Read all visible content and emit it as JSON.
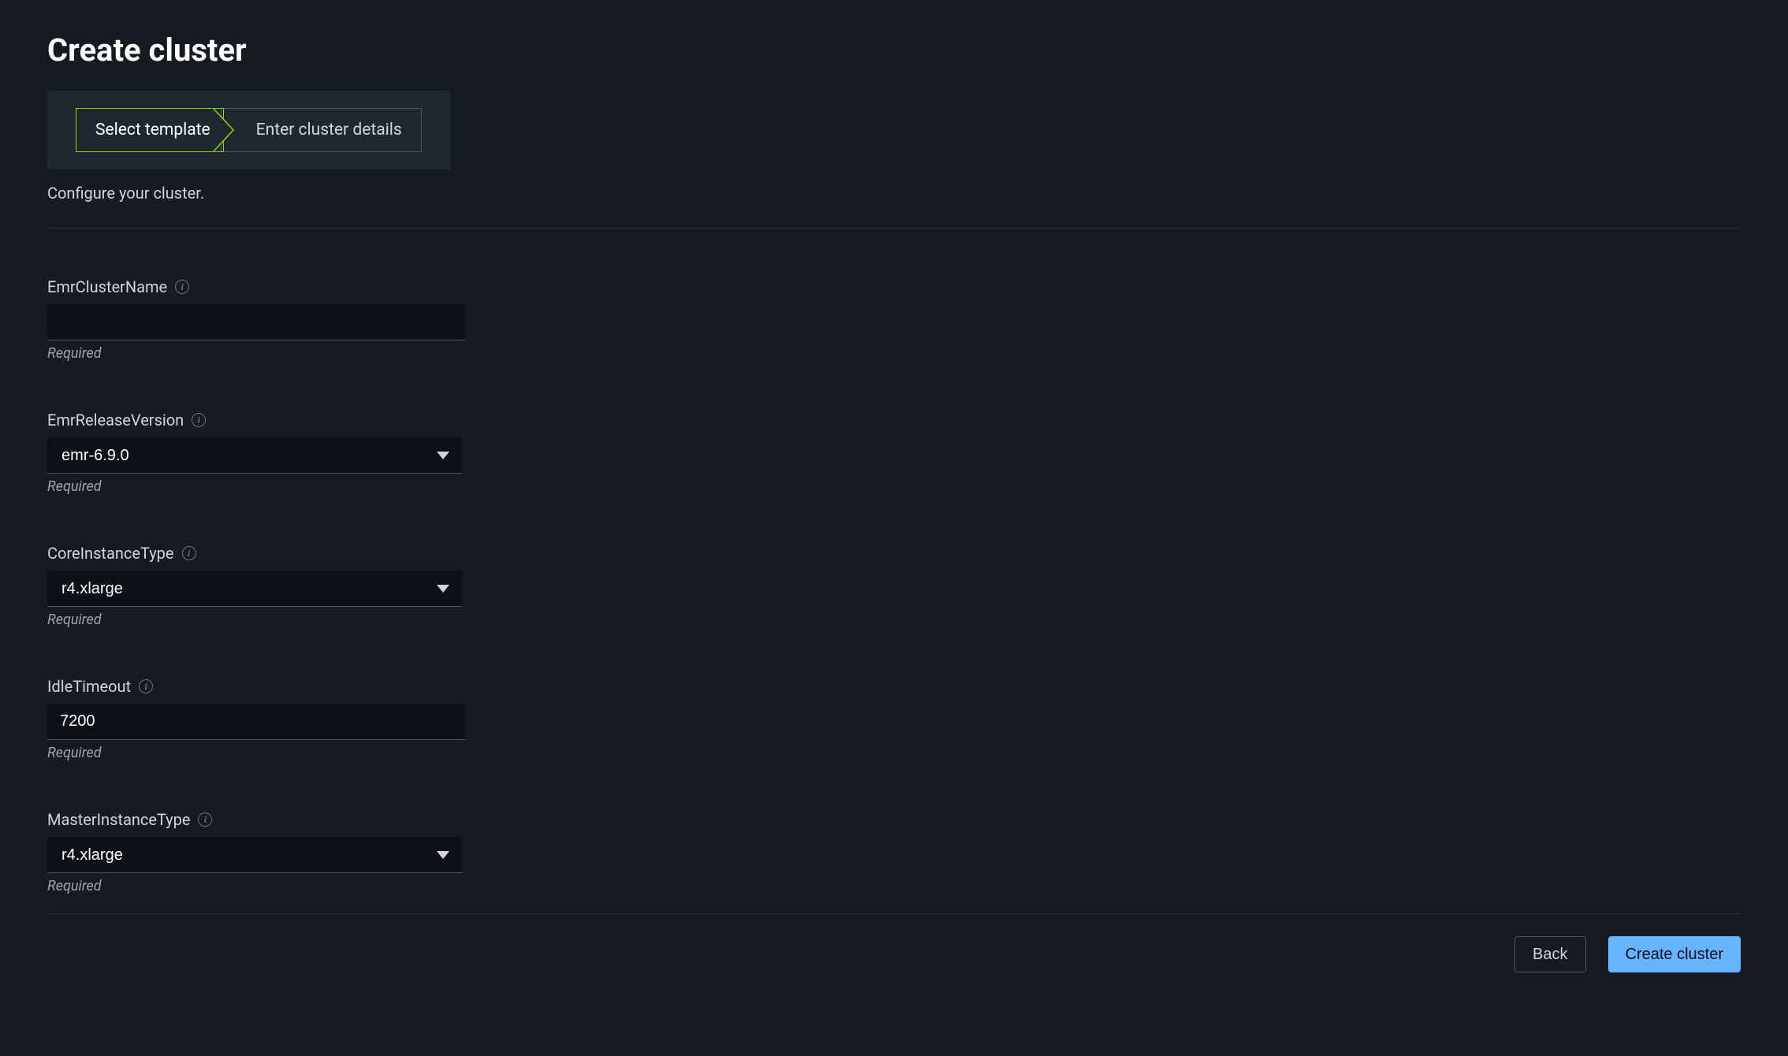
{
  "page": {
    "title": "Create cluster",
    "subtitle": "Configure your cluster."
  },
  "wizard": {
    "step1": "Select template",
    "step2": "Enter cluster details"
  },
  "fields": {
    "emrClusterName": {
      "label": "EmrClusterName",
      "value": "",
      "helper": "Required"
    },
    "emrReleaseVersion": {
      "label": "EmrReleaseVersion",
      "value": "emr-6.9.0",
      "helper": "Required"
    },
    "coreInstanceType": {
      "label": "CoreInstanceType",
      "value": "r4.xlarge",
      "helper": "Required"
    },
    "idleTimeout": {
      "label": "IdleTimeout",
      "value": "7200",
      "helper": "Required"
    },
    "masterInstanceType": {
      "label": "MasterInstanceType",
      "value": "r4.xlarge",
      "helper": "Required"
    }
  },
  "footer": {
    "back": "Back",
    "create": "Create cluster"
  }
}
